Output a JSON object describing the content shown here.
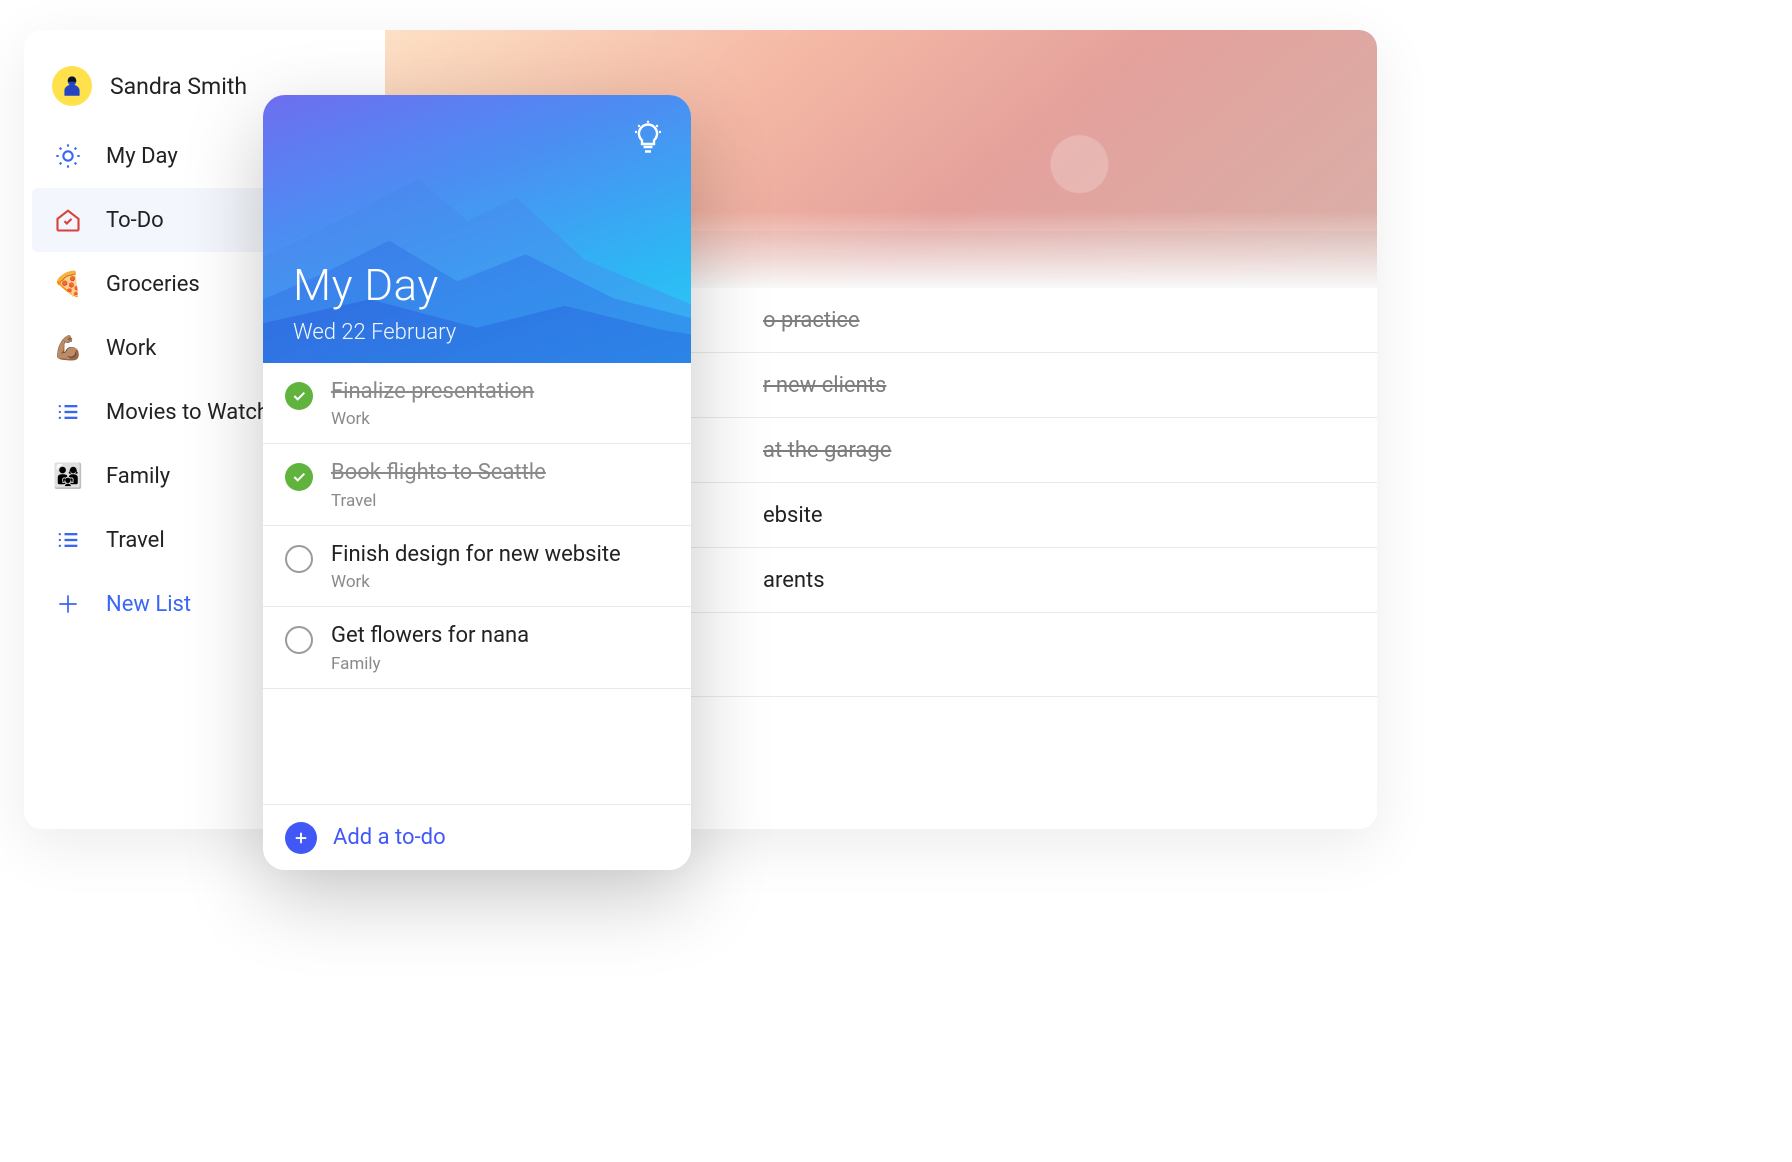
{
  "user": {
    "name": "Sandra Smith"
  },
  "sidebar": {
    "items": [
      {
        "id": "myday",
        "label": "My Day"
      },
      {
        "id": "todo",
        "label": "To-Do",
        "active": true
      },
      {
        "id": "groceries",
        "label": "Groceries",
        "emoji": "🍕"
      },
      {
        "id": "work",
        "label": "Work",
        "emoji": "💪🏽"
      },
      {
        "id": "movies",
        "label": "Movies to Watch"
      },
      {
        "id": "family",
        "label": "Family",
        "emoji": "👨‍👩‍👧"
      },
      {
        "id": "travel",
        "label": "Travel"
      }
    ],
    "new_list_label": "New List"
  },
  "main": {
    "items": [
      {
        "text": "o practice",
        "done": true
      },
      {
        "text": "r new clients",
        "done": true
      },
      {
        "text": "at the garage",
        "done": true
      },
      {
        "text": "ebsite",
        "done": false
      },
      {
        "text": "arents",
        "done": false
      }
    ]
  },
  "mobile": {
    "title": "My Day",
    "date": "Wed 22 February",
    "add_label": "Add a to-do",
    "tasks": [
      {
        "title": "Finalize presentation",
        "list": "Work",
        "done": true
      },
      {
        "title": "Book flights to Seattle",
        "list": "Travel",
        "done": true
      },
      {
        "title": "Finish design for new website",
        "list": "Work",
        "done": false
      },
      {
        "title": "Get flowers for nana",
        "list": "Family",
        "done": false
      }
    ]
  }
}
